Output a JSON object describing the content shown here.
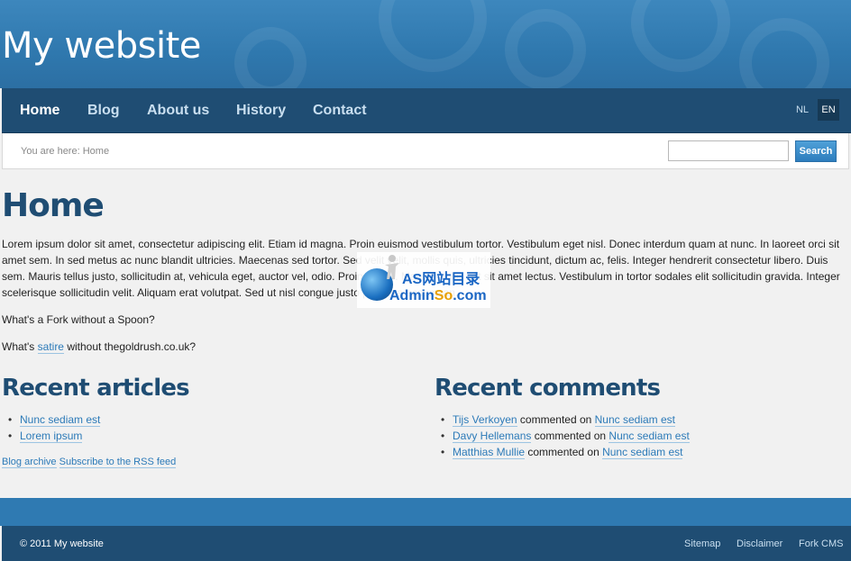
{
  "site": {
    "title": "My website"
  },
  "nav": {
    "items": [
      {
        "label": "Home"
      },
      {
        "label": "Blog"
      },
      {
        "label": "About us"
      },
      {
        "label": "History"
      },
      {
        "label": "Contact"
      }
    ],
    "languages": [
      {
        "label": "NL"
      },
      {
        "label": "EN"
      }
    ]
  },
  "breadcrumb": {
    "prefix": "You are here:",
    "current": "Home"
  },
  "search": {
    "placeholder": "",
    "button_label": "Search"
  },
  "main": {
    "title": "Home",
    "paragraph": "Lorem ipsum dolor sit amet, consectetur adipiscing elit. Etiam id magna. Proin euismod vestibulum tortor. Vestibulum eget nisl. Donec interdum quam at nunc. In laoreet orci sit amet sem. In sed metus ac nunc blandit ultricies. Maecenas sed tortor. Sed velit velit, mollis quis, ultricies tincidunt, dictum ac, felis. Integer hendrerit consectetur libero. Duis sem. Mauris tellus justo, sollicitudin at, vehicula eget, auctor vel, odio. Proin mattis. Mauris mollis elit sit amet lectus. Vestibulum in tortor sodales elit sollicitudin gravida. Integer scelerisque sollicitudin velit. Aliquam erat volutpat. Sed ut nisl congue justo pharetra accumsan.",
    "q1": "What's a Fork without a Spoon?",
    "q2_before": "What's ",
    "q2_link": "satire",
    "q2_after": " without thegoldrush.co.uk?"
  },
  "recent_articles": {
    "title": "Recent articles",
    "items": [
      "Nunc sediam est",
      "Lorem ipsum"
    ],
    "archive_link": "Blog archive",
    "rss_link": "Subscribe to the RSS feed"
  },
  "recent_comments": {
    "title": "Recent comments",
    "items": [
      {
        "author": "Tijs Verkoyen",
        "text": " commented on ",
        "post": "Nunc sediam est"
      },
      {
        "author": "Davy Hellemans",
        "text": " commented on ",
        "post": "Nunc sediam est"
      },
      {
        "author": "Matthias Mullie",
        "text": " commented on ",
        "post": "Nunc sediam est"
      }
    ]
  },
  "watermark": {
    "line1": "AS网站目录",
    "line2_a": "Admin",
    "line2_b": "So",
    "line2_c": ".com"
  },
  "footer": {
    "copyright": "© 2011 My website",
    "links": [
      "Sitemap",
      "Disclaimer",
      "Fork CMS"
    ]
  },
  "colors": {
    "header_blue": "#2f78ae",
    "nav_dark": "#1f4d73",
    "link_blue": "#2c7ab8"
  }
}
